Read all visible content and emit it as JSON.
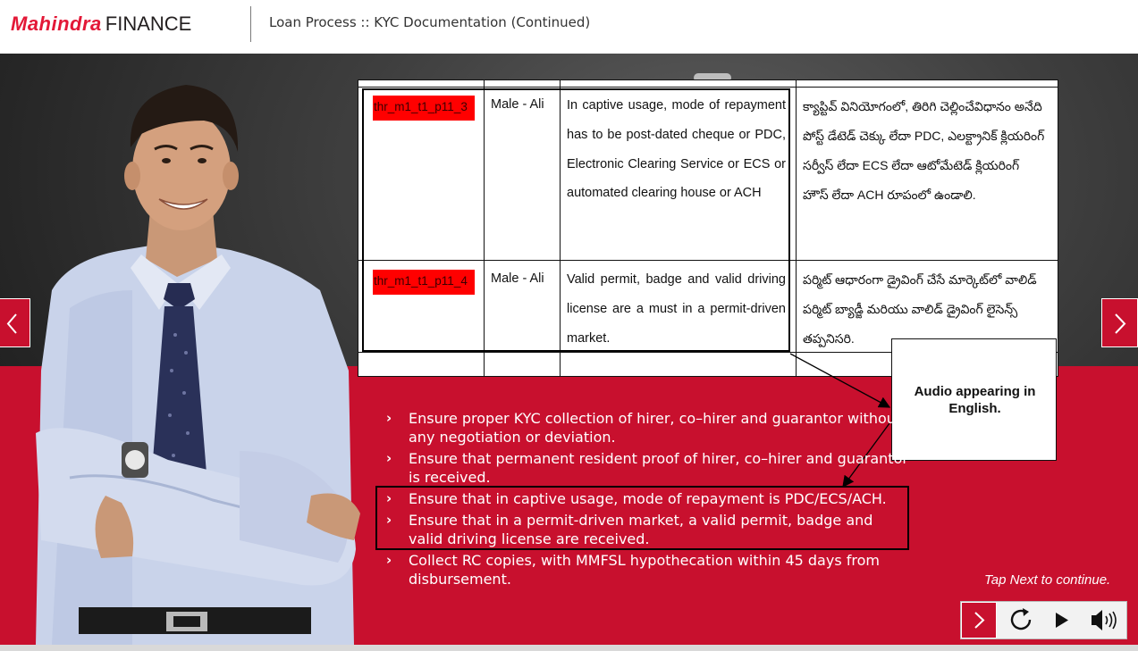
{
  "header": {
    "logo": {
      "part1": "Mahindra",
      "part2": "FINANCE"
    },
    "title": "Loan Process :: KYC Documentation (Continued)"
  },
  "script_table": {
    "rows": [
      {
        "id": "thr_m1_t1_p11_3",
        "voice": "Male - Ali",
        "english": "In captive usage, mode of repayment has to be post-dated cheque or PDC, Electronic Clearing Service or ECS or automated clearing house or ACH",
        "telugu": "క్యాప్టివ్ వినియోగంలో, తిరిగి చెల్లించేవిధానం అనేది పోస్ట్ డేటెడ్ చెక్కు లేదా PDC, ఎలక్ట్రానిక్ క్లియరింగ్ సర్వీస్ లేదా ECS లేదా ఆటోమేటెడ్ క్లియరింగ్ హౌస్ లేదా ACH రూపంలో ఉండాలి."
      },
      {
        "id": "thr_m1_t1_p11_4",
        "voice": "Male - Ali",
        "english": "Valid permit, badge and valid driving license are a must in a permit-driven market.",
        "telugu": "పర్మిట్ ఆధారంగా డ్రైవింగ్ చేసే మార్కెట్‌లో వాలిడ్ పర్మిట్ బ్యాడ్జీ మరియు వాలిడ్ డ్రైవింగ్ లైసెన్స్ తప్పనిసరి."
      }
    ]
  },
  "callout": {
    "text": "Audio appearing in English."
  },
  "bullets": [
    {
      "chevron": "›",
      "text": "Ensure proper KYC collection of hirer, co–hirer and guarantor without any negotiation or deviation."
    },
    {
      "chevron": "›",
      "text": "Ensure that permanent resident proof of hirer, co–hirer and guarantor is received."
    },
    {
      "chevron": "›",
      "text": "Ensure that in captive usage, mode of repayment is PDC/ECS/ACH."
    },
    {
      "chevron": "›",
      "text": "Ensure that in a permit-driven market, a valid permit, badge and valid driving license are received."
    },
    {
      "chevron": "›",
      "text": "Collect RC copies, with MMFSL hypothecation within 45 days from disbursement."
    }
  ],
  "footer": {
    "tap_next": "Tap Next to continue."
  },
  "icons": {
    "prev": "chevron-left-icon",
    "next": "chevron-right-icon",
    "replay": "replay-icon",
    "play": "play-icon",
    "audio": "speaker-icon"
  },
  "colors": {
    "brand_red": "#c8102e",
    "logo_red": "#e31837",
    "id_highlight": "#ff0000"
  }
}
